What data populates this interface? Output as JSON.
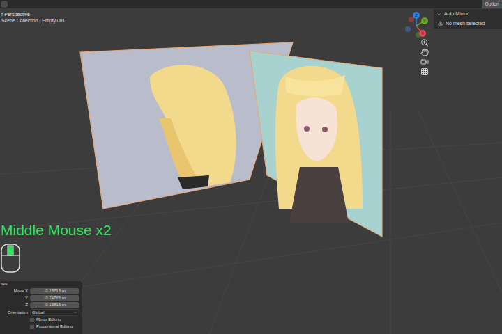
{
  "top_bar": {
    "options_button": "Option"
  },
  "viewport": {
    "view_name": "r Perspective",
    "collection": "Scene Collection | Empty.001"
  },
  "gizmo": {
    "axes": [
      {
        "label": "Z",
        "color": "#2f83e3"
      },
      {
        "label": "Y",
        "color": "#6aa31f"
      },
      {
        "label": "X",
        "color": "#e54b5b"
      }
    ]
  },
  "auto_mirror_panel": {
    "title": "Auto Mirror",
    "expanded": true,
    "message": "No mesh selected"
  },
  "planes": [
    {
      "color": "#b8bccb",
      "selected": true
    },
    {
      "color": "#a8d2d0",
      "selected": true
    }
  ],
  "key_overlay": {
    "text": "Middle Mouse x2",
    "middle_pressed": true
  },
  "operator_panel": {
    "title": "ove",
    "fields": [
      {
        "label": "Move X",
        "value": "-0.28718 m"
      },
      {
        "label": "Y",
        "value": "-0.24765 m"
      },
      {
        "label": "Z",
        "value": "-0.13815 m"
      }
    ],
    "orientation": {
      "label": "Orientation",
      "value": "Global"
    },
    "checkboxes": [
      {
        "label": "Mirror Editing",
        "checked": false
      },
      {
        "label": "Proportional Editing",
        "checked": false
      }
    ]
  }
}
